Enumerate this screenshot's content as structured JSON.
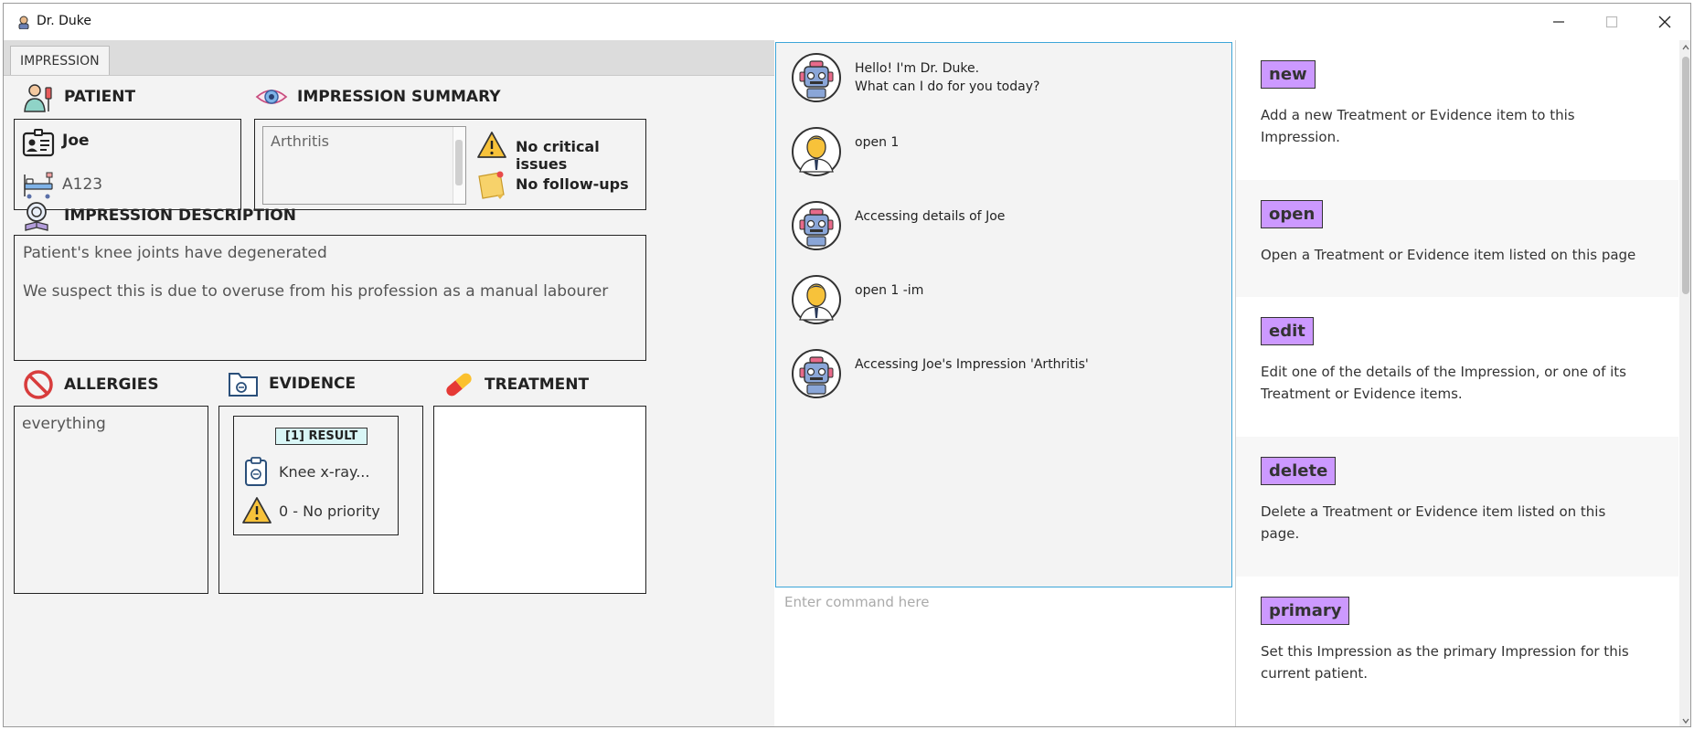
{
  "window": {
    "title": "Dr. Duke"
  },
  "tab": {
    "label": "IMPRESSION"
  },
  "patient": {
    "header": "PATIENT",
    "name": "Joe",
    "id": "A123"
  },
  "summary": {
    "header": "IMPRESSION SUMMARY",
    "impression": "Arthritis",
    "critical": "No critical issues",
    "followups": "No follow-ups"
  },
  "description": {
    "header": "IMPRESSION DESCRIPTION",
    "line1": "Patient's knee joints have degenerated",
    "line2": "We suspect this is due to overuse from his profession as a manual labourer"
  },
  "allergies": {
    "header": "ALLERGIES",
    "text": "everything"
  },
  "evidence": {
    "header": "EVIDENCE",
    "item": {
      "tag": "[1] RESULT",
      "name": "Knee x-ray...",
      "priority": "0 - No priority"
    }
  },
  "treatment": {
    "header": "TREATMENT"
  },
  "chat": {
    "messages": [
      {
        "sender": "bot",
        "text": "Hello! I'm Dr. Duke.\nWhat can I do for you today?"
      },
      {
        "sender": "user",
        "text": "open 1"
      },
      {
        "sender": "bot",
        "text": "Accessing details of Joe"
      },
      {
        "sender": "user",
        "text": "open 1 -im"
      },
      {
        "sender": "bot",
        "text": "Accessing Joe's Impression 'Arthritis'"
      }
    ],
    "placeholder": "Enter command here"
  },
  "help": {
    "commands": [
      {
        "name": "new",
        "desc": "Add a new Treatment or Evidence item to this Impression."
      },
      {
        "name": "open",
        "desc": "Open a Treatment or Evidence item listed on this page"
      },
      {
        "name": "edit",
        "desc": "Edit one of the details of the Impression, or one of its Treatment or Evidence items."
      },
      {
        "name": "delete",
        "desc": "Delete a Treatment or Evidence item listed on this page."
      },
      {
        "name": "primary",
        "desc": "Set this Impression as the primary Impression for this current patient."
      }
    ]
  },
  "colors": {
    "chip": "#cc99ff",
    "chat_border": "#3ca5d8",
    "tag_bg": "#d9f6f6"
  }
}
